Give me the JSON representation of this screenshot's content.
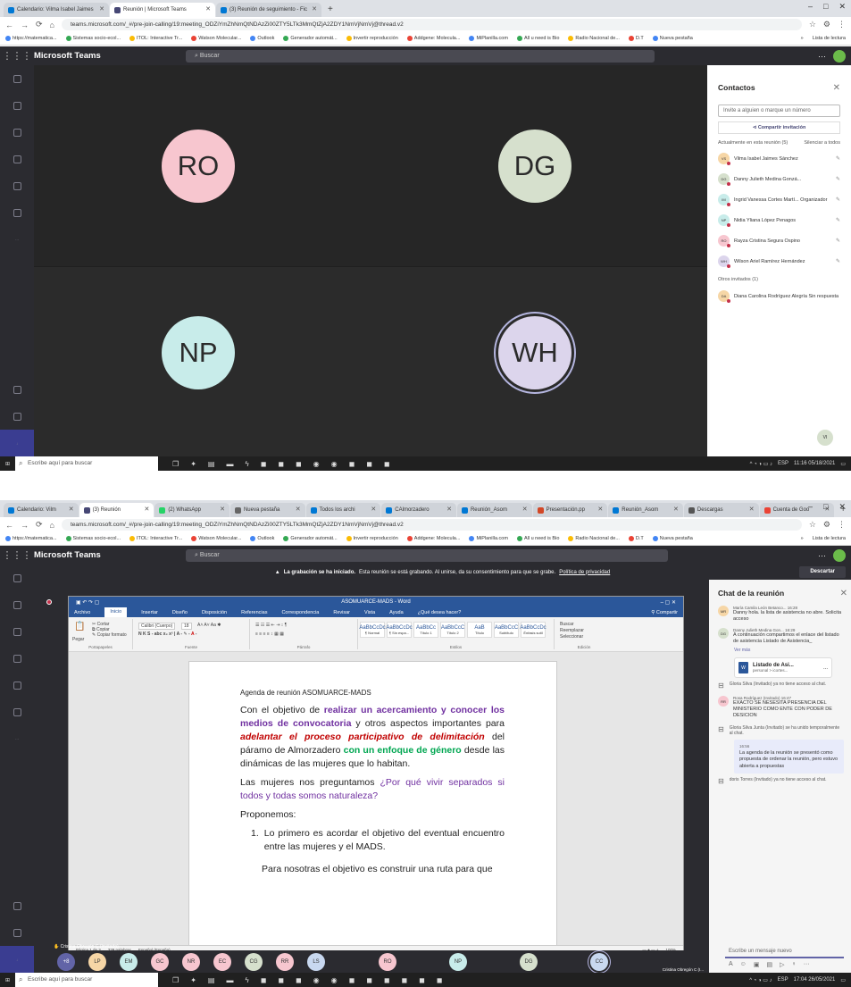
{
  "s1": {
    "tabs": [
      {
        "label": "Calendario: Vilma Isabel Jaimes",
        "color": "#0078d4",
        "active": false
      },
      {
        "label": "Reunión | Microsoft Teams",
        "color": "#464775",
        "active": true
      },
      {
        "label": "(3) Reunión de seguimiento - Fic",
        "color": "#0078d4",
        "active": false
      }
    ],
    "url": "teams.microsoft.com/_#/pre-join-calling/19:meeting_ODZiYmZhNmQtNDAzZi00ZTY5LTk3MmQtZjA2ZDY1NmVjNmVj@thread.v2",
    "bookmarks": [
      "https://matematica...",
      "Sistemas socio-ecol...",
      "ITOL: Interactive Tr...",
      "Watson Molecular...",
      "Outlook",
      "Generador automát...",
      "Invertir reproducción",
      "Addgene: Molecula...",
      "MiPlanilla.com",
      "All u need is Bio",
      "Radio Nacional de...",
      "D.T",
      "Nueva pestaña"
    ],
    "bookmarks_more": "»",
    "reading_list": "Lista de lectura",
    "app_title": "Microsoft Teams",
    "search_placeholder": "Buscar",
    "header_more": "···",
    "participants": [
      {
        "initials": "RO",
        "color": "#f7c6cf"
      },
      {
        "initials": "DG",
        "color": "#d6e0cd"
      },
      {
        "initials": "NP",
        "color": "#c8ecea"
      },
      {
        "initials": "WH",
        "color": "#dcd5ec"
      }
    ],
    "self_initials": "VI",
    "contacts": {
      "title": "Contactos",
      "close": "✕",
      "invite_placeholder": "Invite a alguien o marque un número",
      "share_invite": "Compartir invitación",
      "section_current": "Actualmente en esta reunión (5)",
      "mute_all": "Silenciar a todos",
      "people": [
        {
          "initials": "VS",
          "name": "Vilma Isabel Jaimes Sánchez",
          "color": "#f6d6a6"
        },
        {
          "initials": "DG",
          "name": "Danny Julieth Medina Gonzá...",
          "color": "#d6e0cd"
        },
        {
          "initials": "IM",
          "name": "Ingrid Vanessa Cortes Martí... Organizador",
          "color": "#c8ecea"
        },
        {
          "initials": "NP",
          "name": "Nidia Yliana López Penagos",
          "color": "#c8ecea"
        },
        {
          "initials": "RO",
          "name": "Rayza Cristina Segura Ospino",
          "color": "#f7c6cf"
        },
        {
          "initials": "WH",
          "name": "Wilson Ariel Ramírez Hernández",
          "color": "#dcd5ec"
        }
      ],
      "section_others": "Otros invitados (1)",
      "others": [
        {
          "initials": "DA",
          "name": "Diana Carolina Rodríguez Alegría Sin respuesta",
          "color": "#f6d6a6"
        }
      ]
    },
    "taskbar": {
      "search": "Escribe aquí para buscar",
      "time": "11:16",
      "date": "05/18/2021",
      "lang": "ESP"
    }
  },
  "s2": {
    "tabs": [
      {
        "label": "Calendario: Vilm",
        "color": "#0078d4",
        "active": false
      },
      {
        "label": "(3) Reunión",
        "color": "#464775",
        "active": true
      },
      {
        "label": "(2) WhatsApp",
        "color": "#25d366",
        "active": false
      },
      {
        "label": "Nueva pestaña",
        "color": "#666",
        "active": false
      },
      {
        "label": "Todos los archi",
        "color": "#0078d4",
        "active": false
      },
      {
        "label": "CAlmorzadero",
        "color": "#0078d4",
        "active": false
      },
      {
        "label": "Reunión_Asom",
        "color": "#0078d4",
        "active": false
      },
      {
        "label": "Presentación.pp",
        "color": "#d24726",
        "active": false
      },
      {
        "label": "Reunión_Asom",
        "color": "#0078d4",
        "active": false
      },
      {
        "label": "Descargas",
        "color": "#555",
        "active": false
      },
      {
        "label": "Cuenta de Goo",
        "color": "#ea4335",
        "active": false
      }
    ],
    "url": "teams.microsoft.com/_#/pre-join-calling/19:meeting_ODZiYmZhNmQtNDAzZi00ZTY5LTk3MmQtZjA2ZDY1NmVjNmVj@thread.v2",
    "app_title": "Microsoft Teams",
    "search_placeholder": "Buscar",
    "banner_bold": "La grabación se ha iniciado.",
    "banner_text": "Esta reunión se está grabando. Al unirse, da su consentimiento para que se grabe.",
    "banner_link": "Política de privacidad",
    "discard": "Descartar",
    "word": {
      "title": "ASOMUARCE-MADS - Word",
      "share": "Compartir",
      "menu": [
        "Archivo",
        "Inicio",
        "Insertar",
        "Diseño",
        "Disposición",
        "Referencias",
        "Correspondencia",
        "Revisar",
        "Vista",
        "Ayuda",
        "¿Qué desea hacer?"
      ],
      "groups": [
        "Portapapeles",
        "Fuente",
        "Párrafo",
        "Estilos",
        "Edición"
      ],
      "paste": "Pegar",
      "font": "Calibri (Cuerpo)",
      "size": "18",
      "styles": [
        {
          "sample": "AaBbCcDc",
          "name": "¶ Normal"
        },
        {
          "sample": "AaBbCcDc",
          "name": "¶ Sin espa..."
        },
        {
          "sample": "AaBbCc",
          "name": "Título 1"
        },
        {
          "sample": "AaBbCcC",
          "name": "Título 2"
        },
        {
          "sample": "AaB",
          "name": "Título"
        },
        {
          "sample": "AaBbCcC",
          "name": "Subtítulo"
        },
        {
          "sample": "AaBbCcDc",
          "name": "Énfasis sutil"
        }
      ],
      "edit": [
        "Buscar",
        "Reemplazar",
        "Seleccionar"
      ],
      "doc": {
        "agenda": "Agenda de reunión ASOMUARCE-MADS",
        "p1_a": "Con el objetivo de ",
        "p1_b": "realizar un acercamiento y conocer los medios de convocatoria",
        "p1_c": " y otros aspectos importantes para ",
        "p1_d": "adelantar el proceso participativo de delimitación",
        "p1_e": " del páramo de Almorzadero ",
        "p1_f": "con un enfoque de género",
        "p1_g": " desde las dinámicas de las mujeres que lo habitan.",
        "p2_a": "Las mujeres nos preguntamos ",
        "p2_b": "¿Por qué vivir separados si todos y todas somos naturaleza?",
        "p3": "Proponemos:",
        "li1": "Lo primero es acordar el objetivo del eventual encuentro entre las mujeres y el MADS.",
        "p4": "Para nosotras el objetivo es construir una ruta para que"
      },
      "status_page": "Página 1 de 3",
      "status_words": "339 palabras",
      "status_lang": "Español (España)",
      "zoom": "100%"
    },
    "chat": {
      "title": "Chat de la reunión",
      "close": "✕",
      "messages": [
        {
          "initials": "MR",
          "name": "María Camila León Betanco...",
          "time": "16:28",
          "text": "Danny hola. la lista de asistencia no abre. Solicita acceso",
          "color": "#f6d6a6"
        },
        {
          "initials": "DG",
          "name": "Danny Julieth Medina Gon...",
          "time": "16:29",
          "text": "A continuación compartimos el enlace del listado de asistencia Listado de Asistencia_",
          "color": "#d6e0cd"
        }
      ],
      "seemore": "Ver más",
      "file_name": "Listado de Asi...",
      "file_sub": "personal > icortes...",
      "file_more": "...",
      "sys1": "Gloria Silva (Invitado) ya no tiene acceso al chat.",
      "msg3": {
        "initials": "RR",
        "name": "Rosa Rodríguez (Invitado)",
        "time": "16:47",
        "text": "EXACTO SE NESESITA PRESENCIA DEL MINISTERIO COMO ENTE CON PODER DE DESICION",
        "color": "#f7c6cf"
      },
      "sys2": "Gloria Silva Junta (Invitado) se ha unido temporalmente al chat.",
      "bubble_time": "16:56",
      "bubble_text": "La agenda de la reunión se presentó como propuesta de ordenar la reunión, pero estuvo abierta a propuestas",
      "sys3": "doris Torres (Invitado) ya no tiene acceso al chat.",
      "input_placeholder": "Escribe un mensaje nuevo"
    },
    "strip": [
      {
        "initials": "+8",
        "color": "#6264a7"
      },
      {
        "initials": "LP",
        "color": "#f6d6a6"
      },
      {
        "initials": "EM",
        "color": "#c8ecea"
      },
      {
        "initials": "GC",
        "color": "#f7c6cf"
      },
      {
        "initials": "NR",
        "color": "#f7c6cf"
      },
      {
        "initials": "EC",
        "color": "#f7c6cf"
      },
      {
        "initials": "CG",
        "color": "#d6e0cd"
      },
      {
        "initials": "RR",
        "color": "#f7c6cf"
      },
      {
        "initials": "LS",
        "color": "#c8d8f0"
      }
    ],
    "big_tiles": [
      {
        "initials": "RO",
        "color": "#f7c6cf"
      },
      {
        "initials": "NP",
        "color": "#c8ecea"
      },
      {
        "initials": "DG",
        "color": "#d6e0cd"
      },
      {
        "initials": "CC",
        "color": "#c8d8f0"
      }
    ],
    "presenter_label": "Cristina Obregón C (Invitado)",
    "cc_label": "Cristina Obregón C (I...",
    "taskbar": {
      "search": "Escribe aquí para buscar",
      "time": "17:04",
      "date": "26/05/2021",
      "lang": "ESP"
    }
  }
}
